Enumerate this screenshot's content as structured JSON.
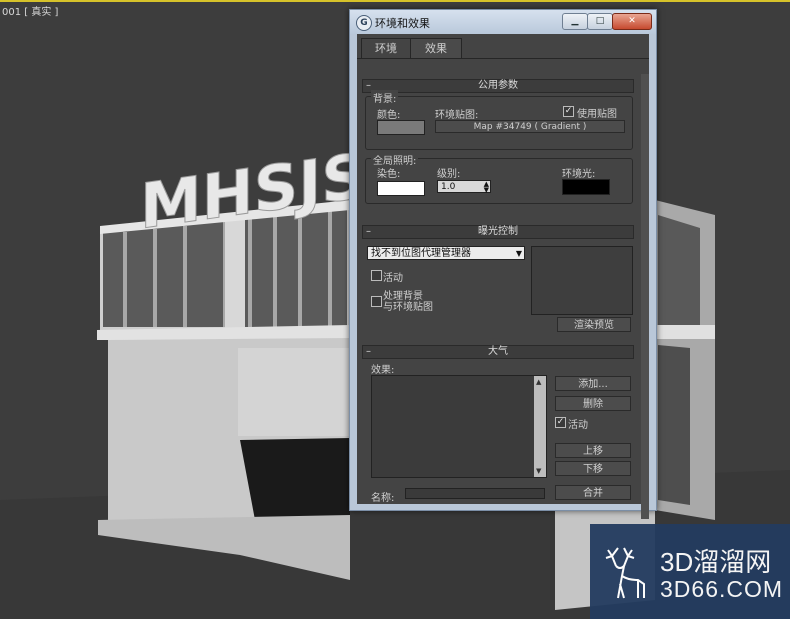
{
  "viewport": {
    "label": "001 [ 真实 ]",
    "sign_text": "MHSJSO"
  },
  "dialog": {
    "title": "环境和效果",
    "icon": "3dsmax-logo-icon",
    "tabs": [
      {
        "label": "环境"
      },
      {
        "label": "效果"
      }
    ],
    "common": {
      "header": "公用参数",
      "background": {
        "legend": "背景:",
        "color_label": "颜色:",
        "color": "#7a7a7a",
        "map_label": "环境贴图:",
        "use_map_label": "使用贴图",
        "use_map_checked": true,
        "map_button": "Map #34749 ( Gradient )"
      },
      "global_lighting": {
        "legend": "全局照明:",
        "tint_label": "染色:",
        "tint_color": "#ffffff",
        "level_label": "级别:",
        "level_value": "1.0",
        "ambient_label": "环境光:",
        "ambient_color": "#000000"
      }
    },
    "exposure": {
      "header": "曝光控制",
      "dropdown_value": "找不到位图代理管理器",
      "active_label": "活动",
      "active_checked": false,
      "process_bg_label_line1": "处理背景",
      "process_bg_label_line2": "与环境贴图",
      "process_bg_checked": false,
      "render_preview_button": "渲染预览"
    },
    "atmosphere": {
      "header": "大气",
      "effects_label": "效果:",
      "add_button": "添加...",
      "delete_button": "删除",
      "active_label": "活动",
      "active_checked": true,
      "move_up_button": "上移",
      "move_down_button": "下移",
      "name_label": "名称:",
      "merge_button": "合并"
    }
  },
  "watermark": {
    "title": "3D溜溜网",
    "domain": "3D66.COM"
  },
  "colors": {
    "viewport_bg": "#3c3c3c",
    "panel_bg": "#444444",
    "titlebar": "#c8d5e4",
    "watermark_bg": "#233c5f"
  }
}
